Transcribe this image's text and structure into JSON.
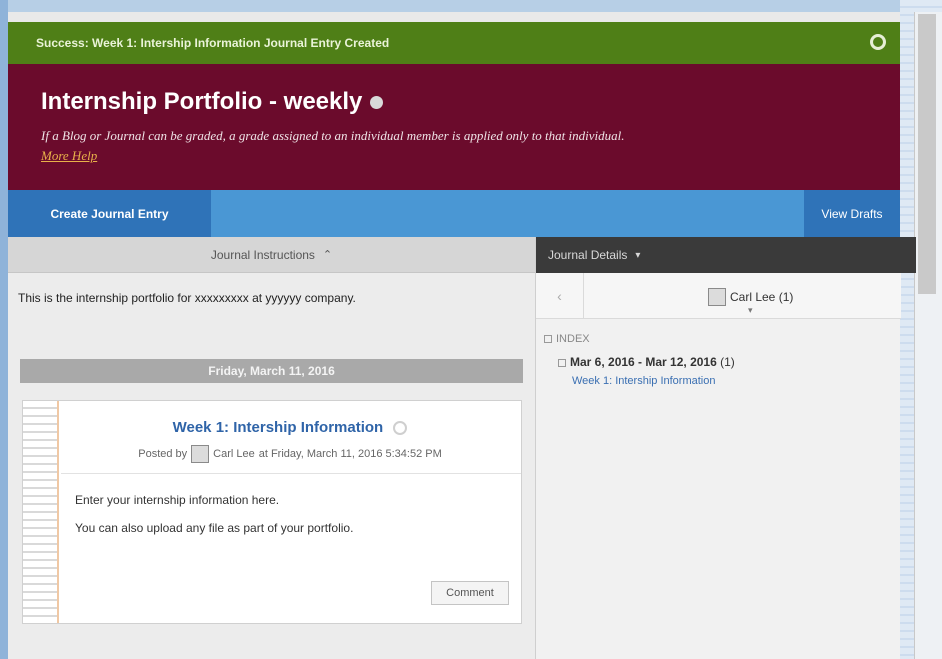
{
  "notification": {
    "message": "Success: Week 1: Intership Information Journal Entry Created",
    "close_icon": "close-circle-icon"
  },
  "header": {
    "title": "Internship Portfolio - weekly",
    "note": "If a Blog or Journal can be graded, a grade assigned to an individual member is applied only to that individual.",
    "help_link": "More Help"
  },
  "actions": {
    "create_label": "Create Journal Entry",
    "drafts_label": "View Drafts"
  },
  "instructions": {
    "heading": "Journal Instructions",
    "caret": "⌃",
    "text": "This is the internship portfolio for xxxxxxxxx at yyyyyy company."
  },
  "entries": {
    "date_header": "Friday, March 11, 2016",
    "items": [
      {
        "title": "Week 1: Intership Information",
        "posted_by_label": "Posted by",
        "author": "Carl Lee",
        "timestamp": "at Friday, March 11, 2016 5:34:52 PM",
        "body": [
          "Enter your internship information here.",
          "You can also upload any file as part of your portfolio."
        ],
        "comment_label": "Comment"
      }
    ]
  },
  "details": {
    "heading": "Journal Details",
    "caret": "▾",
    "prev_arrow": "‹",
    "user": "Carl Lee (1)",
    "user_caret": "▾",
    "index_label": "INDEX",
    "week_range": "Mar 6, 2016 - Mar 12, 2016",
    "week_count": "(1)",
    "week_link": "Week 1: Intership Information"
  },
  "colors": {
    "success": "#4f7f17",
    "header": "#6b0b2c",
    "action_bar": "#4a97d4",
    "button": "#2f73b8",
    "link": "#2f64a8"
  }
}
